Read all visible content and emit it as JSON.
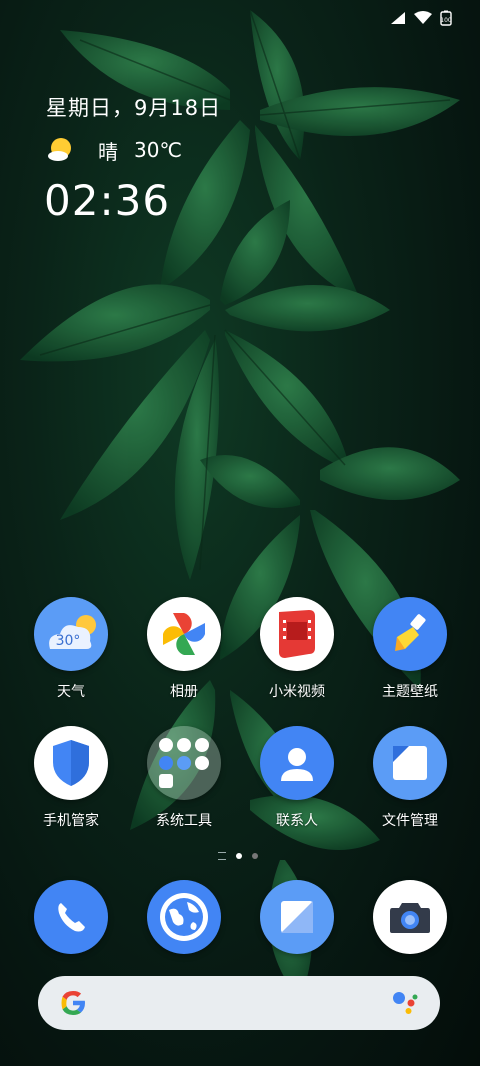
{
  "status_bar": {
    "battery": "100"
  },
  "widget": {
    "date": "星期日，9月18日",
    "weather_condition": "晴",
    "temperature": "30℃",
    "time": "02:36"
  },
  "apps": [
    {
      "label": "天气",
      "icon": "weather-icon",
      "badge": "30°"
    },
    {
      "label": "相册",
      "icon": "gallery-pinwheel-icon"
    },
    {
      "label": "小米视频",
      "icon": "video-icon"
    },
    {
      "label": "主题壁纸",
      "icon": "theme-brush-icon"
    },
    {
      "label": "手机管家",
      "icon": "security-shield-icon"
    },
    {
      "label": "系统工具",
      "icon": "folder-icon"
    },
    {
      "label": "联系人",
      "icon": "contacts-icon"
    },
    {
      "label": "文件管理",
      "icon": "file-manager-icon"
    }
  ],
  "dock": [
    "phone-icon",
    "browser-icon",
    "messages-icon",
    "camera-icon"
  ],
  "pager": {
    "pages": 2,
    "current": 1
  },
  "colors": {
    "blue": "#4285f4",
    "light_blue": "#5b9cf6",
    "red": "#e53935"
  }
}
